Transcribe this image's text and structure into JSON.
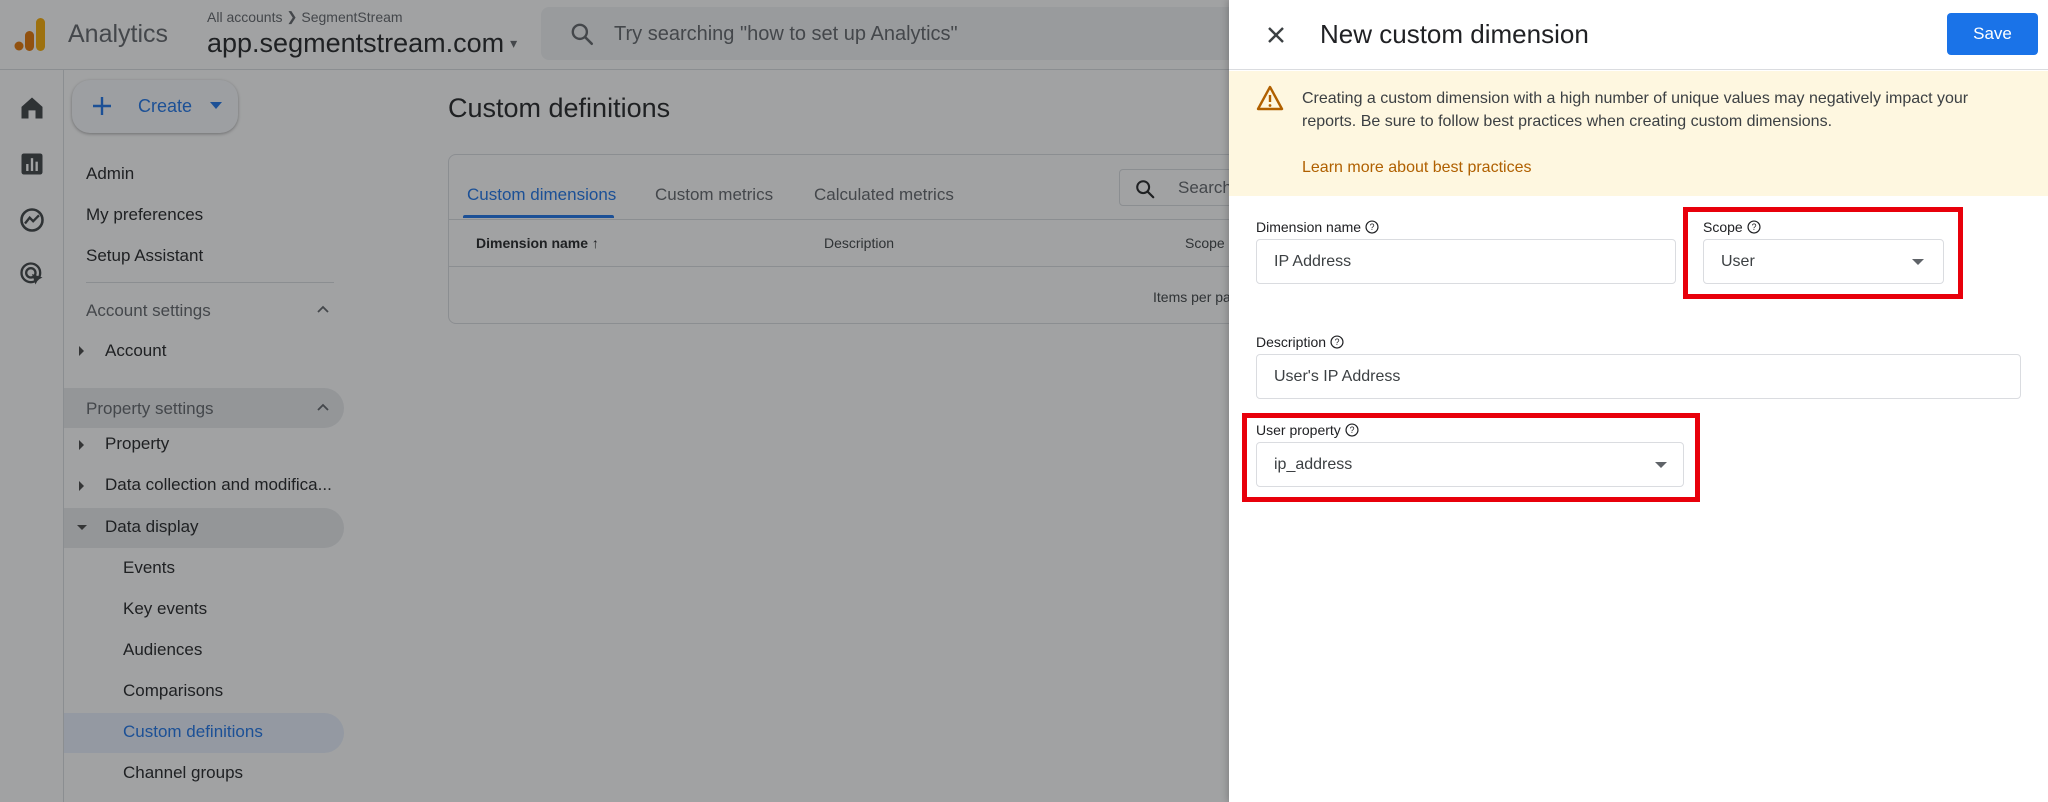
{
  "header": {
    "app_name": "Analytics",
    "breadcrumb_all": "All accounts",
    "breadcrumb_account": "SegmentStream",
    "property": "app.segmentstream.com",
    "search_placeholder": "Try searching \"how to set up Analytics\""
  },
  "rail": [
    "home-icon",
    "reports-icon",
    "explore-icon",
    "advertising-icon"
  ],
  "nav": {
    "create": "Create",
    "admin": "Admin",
    "preferences": "My preferences",
    "setup": "Setup Assistant",
    "account_settings": "Account settings",
    "account": "Account",
    "property_settings": "Property settings",
    "property": "Property",
    "data_collection": "Data collection and modifica...",
    "data_display": "Data display",
    "events": "Events",
    "key_events": "Key events",
    "audiences": "Audiences",
    "comparisons": "Comparisons",
    "custom_definitions": "Custom definitions",
    "channel_groups": "Channel groups"
  },
  "main": {
    "title": "Custom definitions",
    "tabs": [
      "Custom dimensions",
      "Custom metrics",
      "Calculated metrics"
    ],
    "search_placeholder": "Search",
    "columns": [
      "Dimension name",
      "Description",
      "Scope"
    ],
    "items_per_page": "Items per pa"
  },
  "panel": {
    "title": "New custom dimension",
    "save": "Save",
    "warning": "Creating a custom dimension with a high number of unique values may negatively impact your reports. Be sure to follow best practices when creating custom dimensions.",
    "warning_link": "Learn more about best practices",
    "dimension_name_label": "Dimension name",
    "dimension_name_value": "IP Address",
    "scope_label": "Scope",
    "scope_value": "User",
    "description_label": "Description",
    "description_value": "User's IP Address",
    "user_property_label": "User property",
    "user_property_value": "ip_address"
  },
  "colors": {
    "accent": "#1a73e8",
    "highlight": "#e8000b",
    "warning_bg": "#fef7e0",
    "active_nav_bg": "#e8f0fe"
  }
}
